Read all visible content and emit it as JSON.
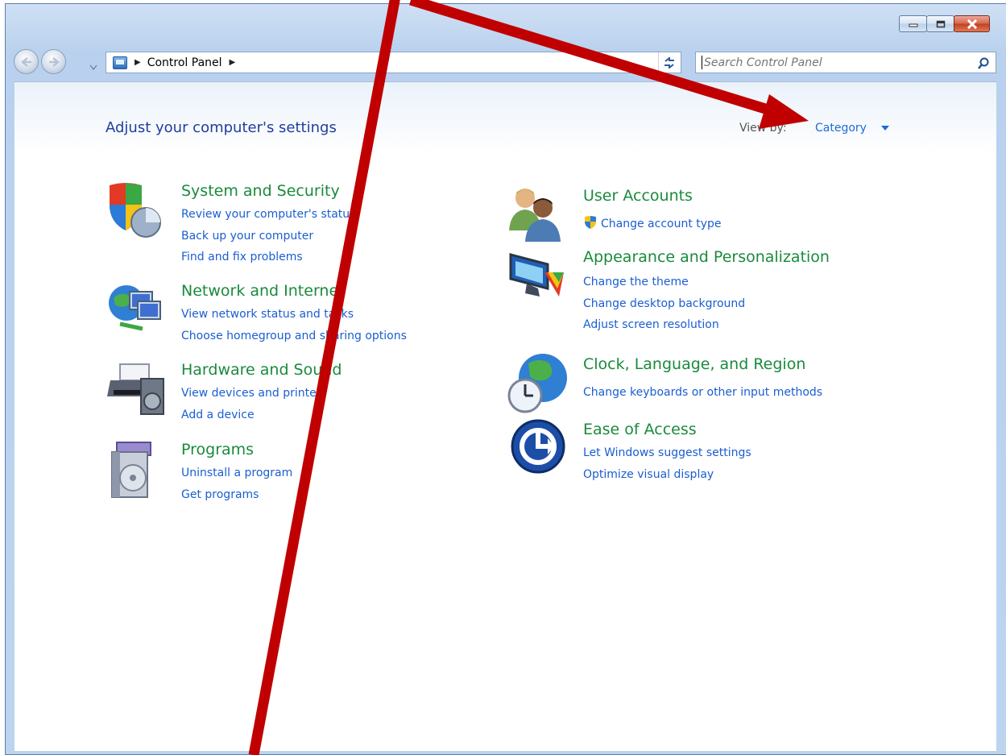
{
  "address": {
    "crumbs": [
      "Control Panel"
    ],
    "search_placeholder": "Search Control Panel"
  },
  "header": {
    "title": "Adjust your computer's settings",
    "view_by_label": "View by:",
    "view_by_value": "Category"
  },
  "categories_left": [
    {
      "title": "System and Security",
      "icon": "shield-pie-icon",
      "links": [
        "Review your computer's status",
        "Back up your computer",
        "Find and fix problems"
      ]
    },
    {
      "title": "Network and Internet",
      "icon": "globe-network-icon",
      "links": [
        "View network status and tasks",
        "Choose homegroup and sharing options"
      ]
    },
    {
      "title": "Hardware and Sound",
      "icon": "printer-speaker-icon",
      "links": [
        "View devices and printers",
        "Add a device"
      ]
    },
    {
      "title": "Programs",
      "icon": "programs-disc-icon",
      "links": [
        "Uninstall a program",
        "Get programs"
      ]
    }
  ],
  "categories_right": [
    {
      "title": "User Accounts",
      "icon": "users-icon",
      "links": [
        "Change account type"
      ]
    },
    {
      "title": "Appearance and Personalization",
      "icon": "monitor-palette-icon",
      "links": [
        "Change the theme",
        "Change desktop background",
        "Adjust screen resolution"
      ]
    },
    {
      "title": "Clock, Language, and Region",
      "icon": "globe-clock-icon",
      "links": [
        "Change keyboards or other input methods"
      ]
    },
    {
      "title": "Ease of Access",
      "icon": "ease-of-access-icon",
      "links": [
        "Let Windows suggest settings",
        "Optimize visual display"
      ]
    }
  ],
  "colors": {
    "category_title": "#1a8a3c",
    "link": "#1a5ed1",
    "heading": "#1e3e9e",
    "annotation_arrow": "#c00000"
  }
}
